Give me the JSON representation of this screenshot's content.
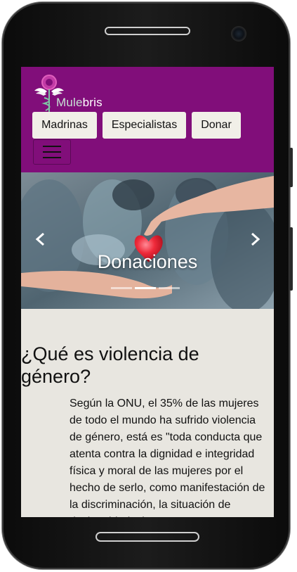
{
  "brand": {
    "name_prefix": "Mule",
    "name_suffix": "bris",
    "logo_icon": "venus-caduceus-wings-logo"
  },
  "nav": {
    "buttons": [
      "Madrinas",
      "Especialistas",
      "Donar"
    ],
    "toggler_icon": "hamburger-icon"
  },
  "carousel": {
    "caption": "Donaciones",
    "slide_count": 3,
    "active_index": 1,
    "prev_icon": "chevron-left-icon",
    "next_icon": "chevron-right-icon"
  },
  "article": {
    "heading": "¿Qué es violencia de género?",
    "body": "Según la ONU, el 35% de las mujeres de todo el mundo ha sufrido violencia de género, está es \"toda conducta que atenta contra la dignidad e integridad física y moral de las mujeres por el hecho de serlo, como manifestación de la discriminación, la situación de desigualdad y las"
  },
  "colors": {
    "navbar": "#810e7a",
    "page_bg": "#e8e6e0",
    "button_bg": "#f1efe8"
  }
}
